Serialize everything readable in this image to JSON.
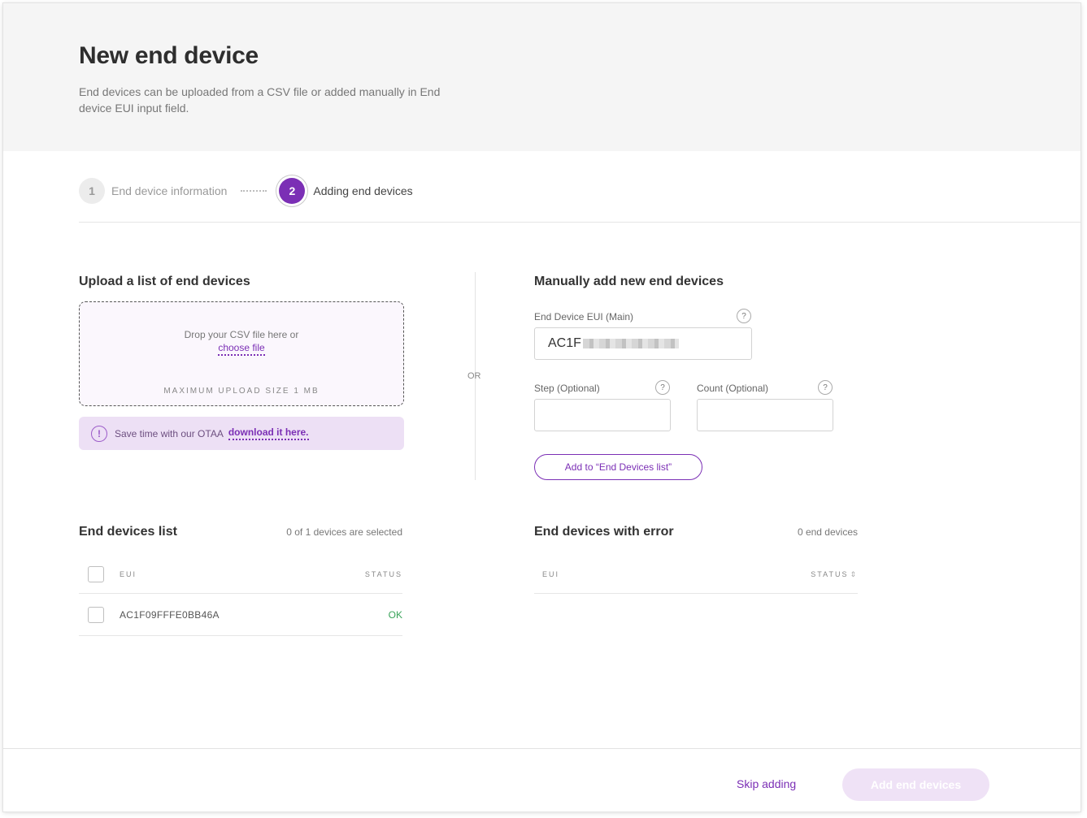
{
  "header": {
    "title": "New end device",
    "description": "End devices can be uploaded from a CSV file or added manually in End device EUI input field."
  },
  "stepper": {
    "steps": [
      {
        "number": "1",
        "label": "End device information",
        "state": "done"
      },
      {
        "number": "2",
        "label": "Adding end devices",
        "state": "active"
      }
    ]
  },
  "upload": {
    "title": "Upload a list of end devices",
    "drop_text": "Drop your CSV file here or",
    "choose_link": "choose file",
    "max_size": "MAXIMUM UPLOAD SIZE 1 MB",
    "banner_text": "Save time with our OTAA",
    "banner_link": "download it here.",
    "banner_icon": "!"
  },
  "separator": {
    "or_label": "OR"
  },
  "manual": {
    "title": "Manually add new end devices",
    "eui_label": "End Device EUI (Main)",
    "eui_value": "AC1F",
    "step_label": "Step (Optional)",
    "step_value": "",
    "count_label": "Count (Optional)",
    "count_value": "",
    "help_glyph": "?",
    "add_button": "Add to “End Devices list”"
  },
  "devices_list": {
    "title": "End devices list",
    "selected_text": "0 of 1 devices are selected",
    "columns": {
      "eui": "EUI",
      "status": "STATUS"
    },
    "rows": [
      {
        "eui": "AC1F09FFFE0BB46A",
        "status": "OK"
      }
    ]
  },
  "error_list": {
    "title": "End devices with error",
    "count_text": "0 end devices",
    "columns": {
      "eui": "EUI",
      "status": "STATUS"
    },
    "sort_glyph": "⇕"
  },
  "footer": {
    "skip_label": "Skip adding",
    "submit_label": "Add end devices"
  },
  "colors": {
    "accent": "#7b2fb5",
    "ok": "#3aa35a",
    "banner_bg": "#ede0f5",
    "disabled_btn": "#efe2f6"
  }
}
